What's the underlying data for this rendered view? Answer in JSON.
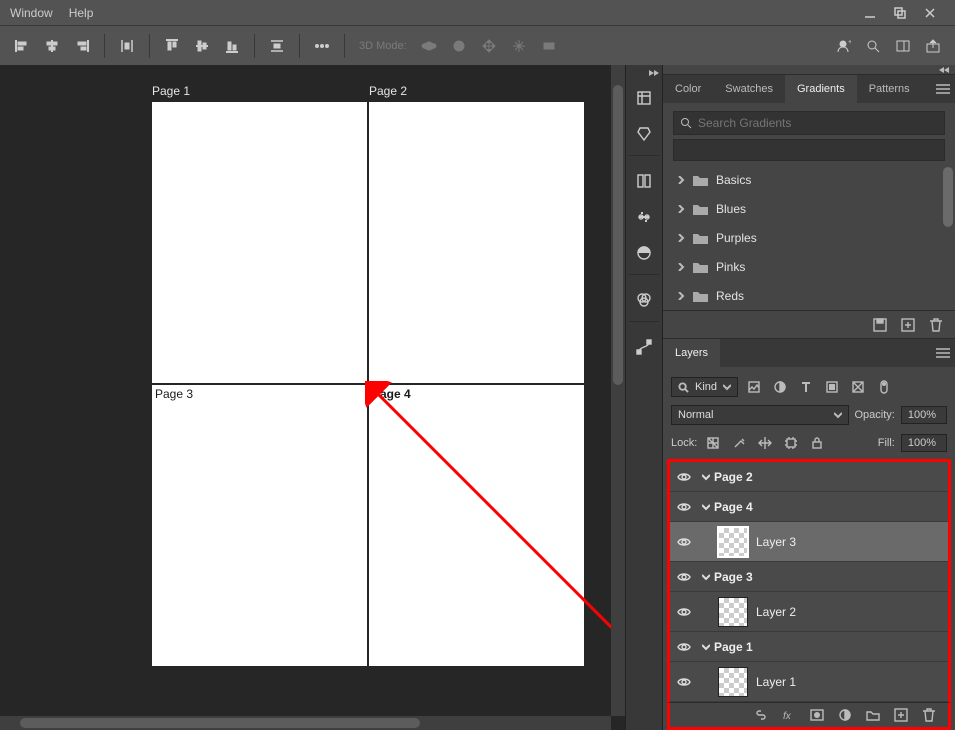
{
  "menubar": {
    "items": [
      "Window",
      "Help"
    ]
  },
  "optbar": {
    "mode3d_label": "3D Mode:"
  },
  "canvas": {
    "pages": [
      "Page 1",
      "Page 2",
      "Page 3",
      "Page 4"
    ]
  },
  "panel_color": {
    "tabs": [
      "Color",
      "Swatches",
      "Gradients",
      "Patterns"
    ],
    "active_tab": 2,
    "search_placeholder": "Search Gradients",
    "folders": [
      "Basics",
      "Blues",
      "Purples",
      "Pinks",
      "Reds"
    ]
  },
  "panel_layers": {
    "tab": "Layers",
    "filter_kind": "Kind",
    "blend_mode": "Normal",
    "opacity_label": "Opacity:",
    "opacity_value": "100%",
    "lock_label": "Lock:",
    "fill_label": "Fill:",
    "fill_value": "100%",
    "tree": [
      {
        "type": "group",
        "name": "Page 2",
        "open": true
      },
      {
        "type": "group",
        "name": "Page 4",
        "open": true
      },
      {
        "type": "layer",
        "name": "Layer 3",
        "selected": true
      },
      {
        "type": "group",
        "name": "Page 3",
        "open": true
      },
      {
        "type": "layer",
        "name": "Layer 2"
      },
      {
        "type": "group",
        "name": "Page 1",
        "open": true
      },
      {
        "type": "layer",
        "name": "Layer 1"
      }
    ]
  }
}
